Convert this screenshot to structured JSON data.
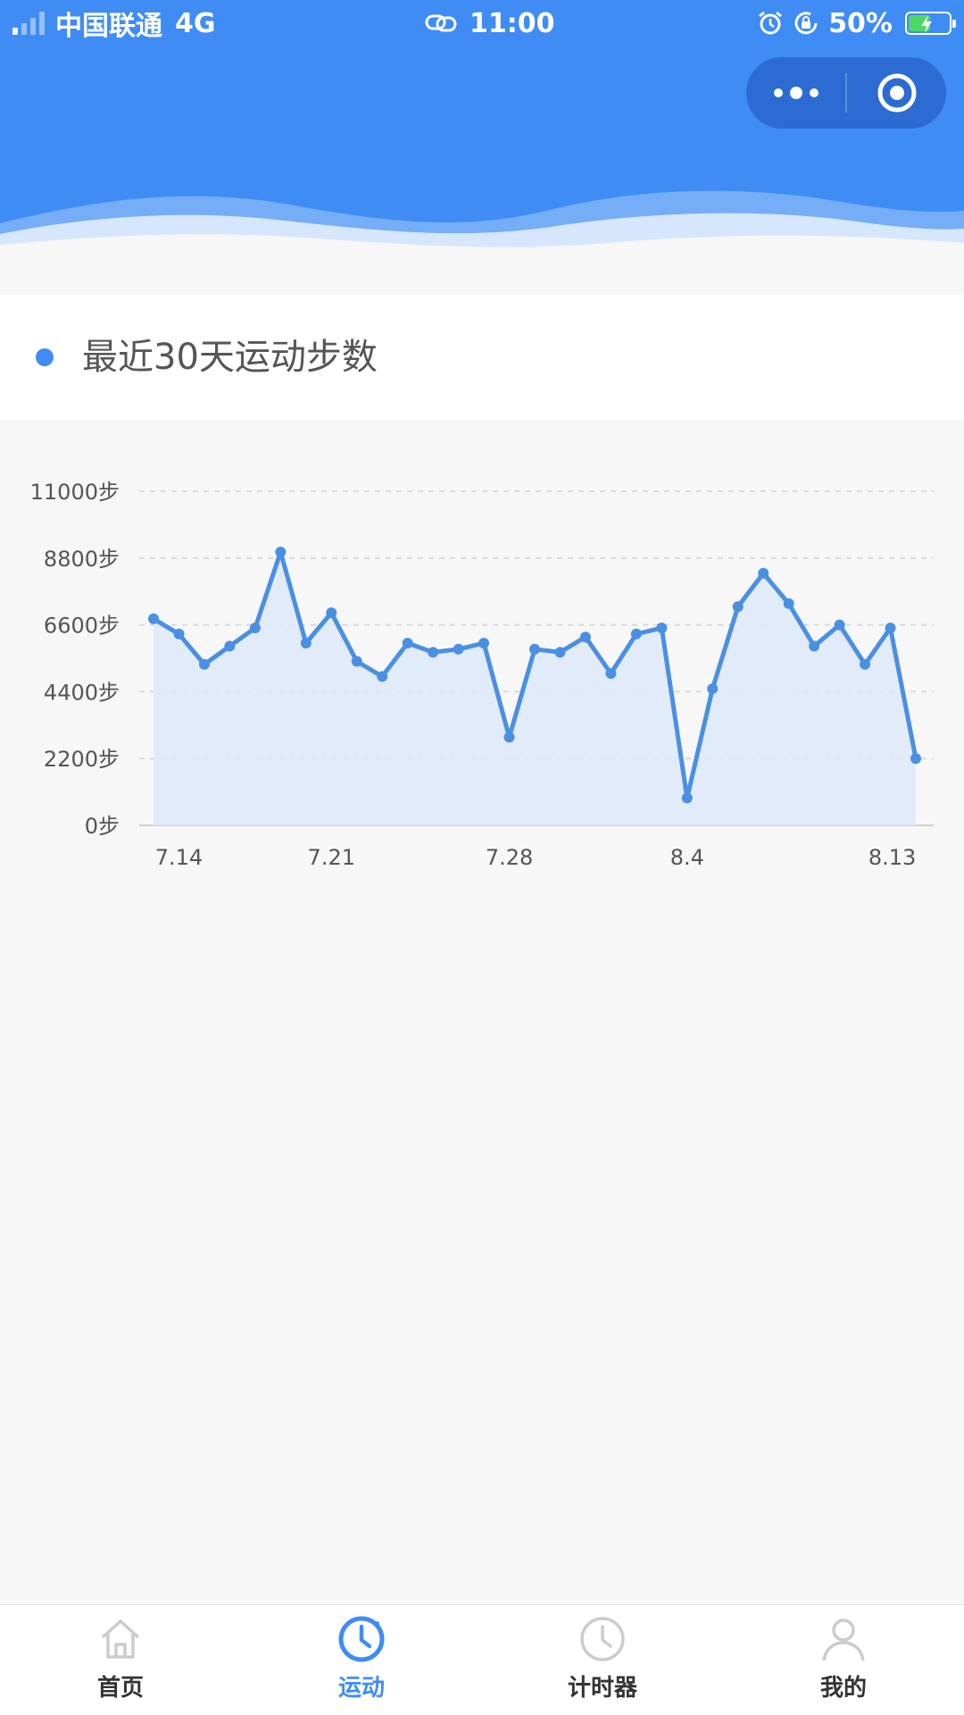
{
  "colors": {
    "primary": "#3f8cf5",
    "line": "#4a90e2",
    "area": "#dde9f9",
    "tab_inactive_icon": "#cccccc",
    "battery": "#4cd964"
  },
  "status_bar": {
    "carrier": "中国联通",
    "network": "4G",
    "time": "11:00",
    "battery": "50%"
  },
  "capsule": {
    "more_icon": "more-dots-icon",
    "close_icon": "target-circle-icon"
  },
  "section": {
    "title": "最近30天运动步数"
  },
  "chart_data": {
    "type": "area",
    "title": "",
    "xlabel": "",
    "ylabel": "",
    "ylim": [
      0,
      11000
    ],
    "y_ticks": [
      0,
      2200,
      4400,
      6600,
      8800,
      11000
    ],
    "y_tick_labels": [
      "0步",
      "2200步",
      "4400步",
      "6600步",
      "8800步",
      "11000步"
    ],
    "grid": true,
    "x_tick_labels": [
      "7.14",
      "7.21",
      "7.28",
      "8.4",
      "8.13"
    ],
    "series": [
      {
        "values": [
          6800,
          6300,
          5300,
          5900,
          6500,
          9000,
          6000,
          7000,
          5400,
          4900,
          6000,
          5700,
          5800,
          6000,
          2900,
          5800,
          5700,
          6200,
          5000,
          6300,
          6500,
          900,
          4500,
          7200,
          8300,
          7300,
          5900,
          6600,
          5300,
          6500,
          2200
        ]
      }
    ]
  },
  "tabbar": {
    "items": [
      {
        "label": "首页",
        "icon": "home-icon",
        "active": false
      },
      {
        "label": "运动",
        "icon": "clock-icon",
        "active": true
      },
      {
        "label": "计时器",
        "icon": "timer-icon",
        "active": false
      },
      {
        "label": "我的",
        "icon": "user-icon",
        "active": false
      }
    ]
  }
}
